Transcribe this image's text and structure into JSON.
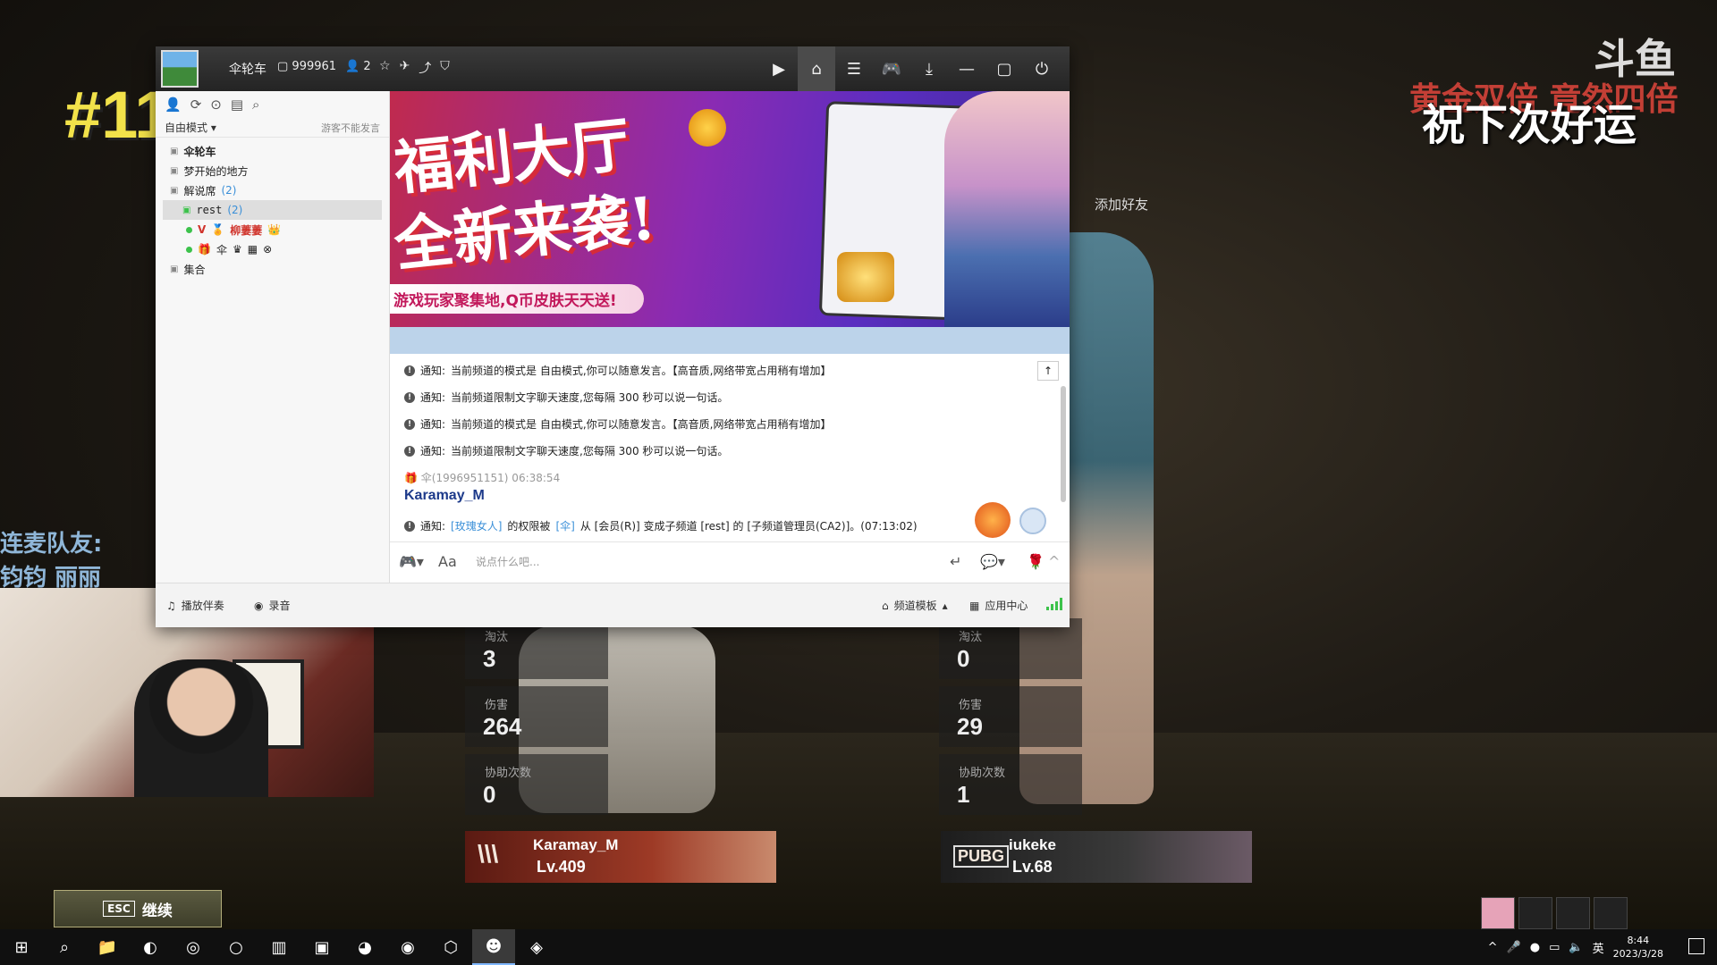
{
  "overlay": {
    "rank": "#11",
    "douyu_logo": "斗鱼",
    "banner_red": "黄金双倍 竟然四倍",
    "banner_white": "祝下次好运",
    "teammate_label": "连麦队友:",
    "teammate_names": "钧钧 丽丽",
    "add_friend": "添加好友",
    "esc_key": "ESC",
    "esc_label": "继续"
  },
  "stats_left": [
    {
      "label": "淘汰",
      "value": "3"
    },
    {
      "label": "伤害",
      "value": "264"
    },
    {
      "label": "协助次数",
      "value": "0"
    }
  ],
  "stats_right": [
    {
      "label": "淘汰",
      "value": "0"
    },
    {
      "label": "伤害",
      "value": "29"
    },
    {
      "label": "协助次数",
      "value": "1"
    }
  ],
  "players": [
    {
      "name": "Karamay_M",
      "level": "Lv.409",
      "emblem": "\\\\\\"
    },
    {
      "name": "iukeke",
      "level": "Lv.68",
      "emblem": "PUBG"
    }
  ],
  "window": {
    "channel_name": "伞轮车",
    "channel_id": "999961",
    "online_count": "2",
    "mode_label": "自由模式",
    "mode_note": "游客不能发言",
    "tree": [
      {
        "label": "伞轮车"
      },
      {
        "label": "梦开始的地方"
      },
      {
        "label": "解说席",
        "count": "(2)"
      },
      {
        "label": "rest",
        "count": "(2)"
      },
      {
        "label": "柳萋萋"
      },
      {
        "label": "伞"
      },
      {
        "label": "集合"
      }
    ],
    "banner": {
      "line1": "福利大厅",
      "line2": "全新来袭!",
      "sub": "游戏玩家聚集地,Q币皮肤天天送!"
    },
    "messages": [
      {
        "prefix": "通知:",
        "text": "当前频道的模式是 自由模式,你可以随意发言。【高音质,网络带宽占用稍有增加】"
      },
      {
        "prefix": "通知:",
        "text": "当前频道限制文字聊天速度,您每隔 300 秒可以说一句话。"
      },
      {
        "prefix": "通知:",
        "text": "当前频道的模式是 自由模式,你可以随意发言。【高音质,网络带宽占用稍有增加】"
      },
      {
        "prefix": "通知:",
        "text": "当前频道限制文字聊天速度,您每隔 300 秒可以说一句话。"
      }
    ],
    "sender": {
      "meta": "伞(1996951151) 06:38:54",
      "name": "Karamay_M"
    },
    "last_notice": {
      "prefix": "通知:",
      "user": "[玫瑰女人]",
      "mid1": " 的权限被 ",
      "by": "[伞]",
      "rest": " 从 [会员(R)] 变成子频道 [rest] 的 [子频道管理员(CA2)]。(07:13:02)"
    },
    "input_placeholder": "说点什么吧...",
    "bottom": {
      "music": "播放伴奏",
      "record": "录音",
      "template": "频道模板",
      "app_center": "应用中心"
    }
  },
  "taskbar": {
    "ime": "英",
    "time": "8:44",
    "date": "2023/3/28"
  }
}
